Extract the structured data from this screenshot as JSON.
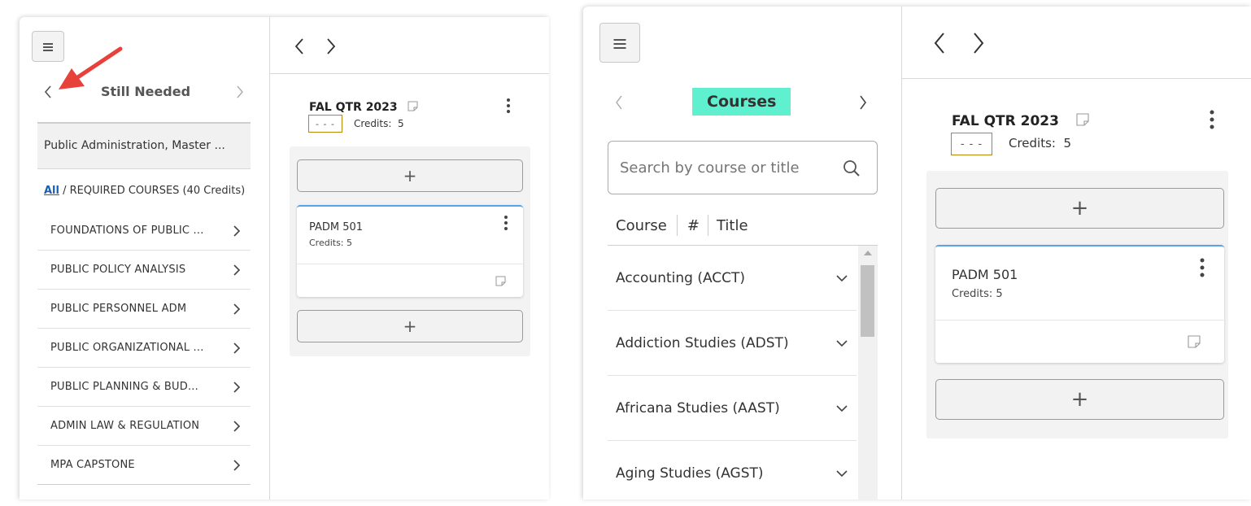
{
  "left_panel": {
    "menu_icon": "hamburger-icon",
    "sidebar": {
      "title": "Still Needed",
      "degree": "Public Administration, Master ...",
      "breadcrumb_all": "All",
      "breadcrumb_rest": " / REQUIRED COURSES (40 Credits)",
      "items": [
        {
          "label": "FOUNDATIONS OF PUBLIC ..."
        },
        {
          "label": "PUBLIC POLICY ANALYSIS"
        },
        {
          "label": "PUBLIC PERSONNEL ADM"
        },
        {
          "label": "PUBLIC ORGANIZATIONAL ..."
        },
        {
          "label": "PUBLIC PLANNING & BUD..."
        },
        {
          "label": "ADMIN LAW & REGULATION"
        },
        {
          "label": "MPA CAPSTONE"
        }
      ]
    },
    "term": {
      "name": "FAL QTR 2023",
      "placeholder": "- - -",
      "credits_label": "Credits:",
      "credits_value": "5",
      "add_label": "+",
      "course_code": "PADM 501",
      "course_credits": "Credits: 5"
    }
  },
  "right_panel": {
    "menu_icon": "hamburger-icon",
    "sidebar": {
      "title": "Courses",
      "title_highlight": "#5ff0cf",
      "search_placeholder": "Search by course or title",
      "col_course": "Course",
      "col_number": "#",
      "col_title": "Title",
      "subjects": [
        {
          "label": "Accounting (ACCT)"
        },
        {
          "label": "Addiction Studies (ADST)"
        },
        {
          "label": "Africana Studies (AAST)"
        },
        {
          "label": "Aging Studies (AGST)"
        }
      ]
    },
    "term": {
      "name": "FAL QTR 2023",
      "placeholder": "- - -",
      "credits_label": "Credits:",
      "credits_value": "5",
      "add_label": "+",
      "course_code": "PADM 501",
      "course_credits": "Credits: 5"
    }
  },
  "annotation": {
    "color": "#e8413a",
    "icon": "arrow-icon"
  },
  "colors": {
    "card_accent": "#5ba3e8",
    "placeholder_border": "#b8860b",
    "link": "#1a5fb4"
  }
}
